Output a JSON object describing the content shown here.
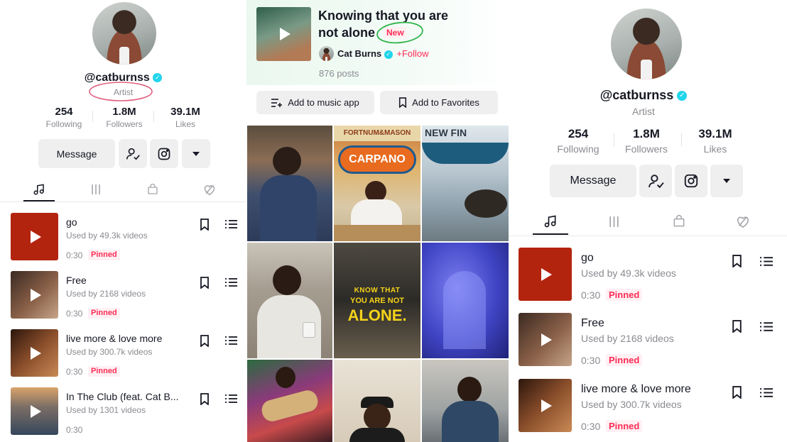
{
  "profile": {
    "username": "@catburnss",
    "role": "Artist",
    "stats": [
      {
        "num": "254",
        "label": "Following"
      },
      {
        "num": "1.8M",
        "label": "Followers"
      },
      {
        "num": "39.1M",
        "label": "Likes"
      }
    ],
    "message_label": "Message"
  },
  "tabs": [
    {
      "icon": "music-note-icon"
    },
    {
      "icon": "bars-icon"
    },
    {
      "icon": "shop-bag-icon"
    },
    {
      "icon": "liked-icon"
    }
  ],
  "songs": [
    {
      "title": "go",
      "used": "Used by 49.3k videos",
      "duration": "0:30",
      "pinned": "Pinned",
      "color": "#b3240f"
    },
    {
      "title": "Free",
      "used": "Used by 2168 videos",
      "duration": "0:30",
      "pinned": "Pinned",
      "color": "#6b4a36"
    },
    {
      "title": "live more & love more",
      "used": "Used by 300.7k videos",
      "duration": "0:30",
      "pinned": "Pinned",
      "color": "#8a4e2b"
    },
    {
      "title": "In The Club (feat. Cat B...",
      "used": "Used by 1301 videos",
      "duration": "0:30",
      "pinned": "",
      "color": "#4b6a86"
    }
  ],
  "middle": {
    "sound_title_line1": "Knowing that you are",
    "sound_title_line2": "not alone",
    "new_badge": "New",
    "artist": "Cat Burns",
    "follow": "+Follow",
    "posts": "876 posts",
    "add_music_app": "Add to music app",
    "add_favorites": "Add to Favorites",
    "overlay_line1": "KNOW THAT",
    "overlay_line2": "YOU ARE NOT",
    "overlay_line3": "ALONE.",
    "sign_top": "FORTNUM&MASON",
    "sign_main": "CARPANO",
    "sign_window": "NEW FIN"
  },
  "colors": {
    "accent": "#fe2c55",
    "verified": "#20d5ec",
    "circle_annotation": "#e0607e",
    "new_circle": "#2fb34a"
  }
}
